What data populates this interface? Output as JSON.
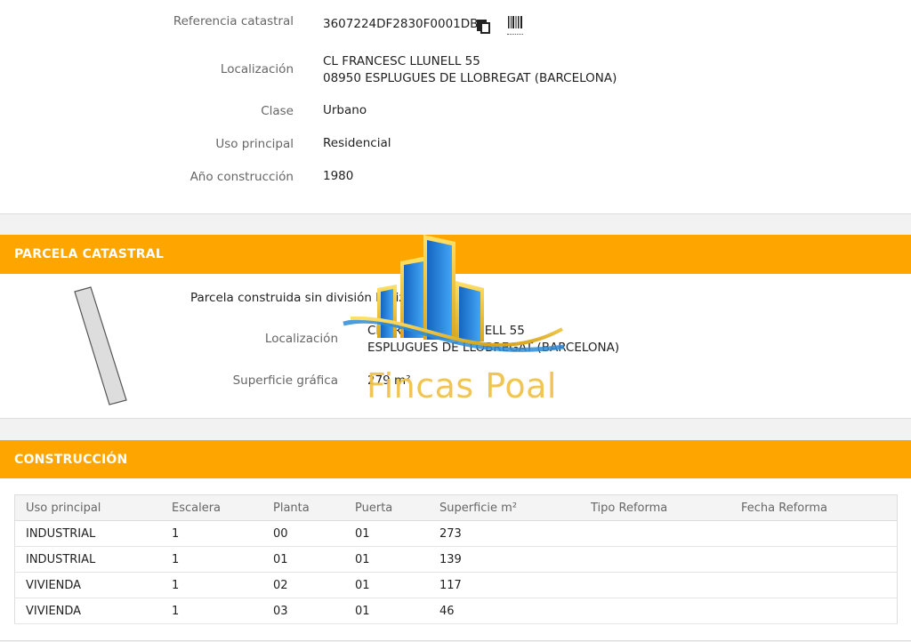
{
  "summary": {
    "ref_label": "Referencia catastral",
    "ref_value": "3607224DF2830F0001DB",
    "loc_label": "Localización",
    "loc_line1": "CL FRANCESC LLUNELL 55",
    "loc_line2": "08950 ESPLUGUES DE LLOBREGAT (BARCELONA)",
    "clase_label": "Clase",
    "clase_value": "Urbano",
    "uso_label": "Uso principal",
    "uso_value": "Residencial",
    "ano_label": "Año construcción",
    "ano_value": "1980",
    "icons": {
      "copy": "copy-icon",
      "barcode": "barcode-icon"
    }
  },
  "parcela": {
    "title": "PARCELA CATASTRAL",
    "description": "Parcela construida sin división horizontal",
    "loc_label": "Localización",
    "loc_line1": "CL FRANCESC LLUNELL 55",
    "loc_line2": "ESPLUGUES DE LLOBREGAT (BARCELONA)",
    "sup_label": "Superficie gráfica",
    "sup_value": "279 m²"
  },
  "construccion": {
    "title": "CONSTRUCCIÓN",
    "columns": [
      "Uso principal",
      "Escalera",
      "Planta",
      "Puerta",
      "Superficie m²",
      "Tipo Reforma",
      "Fecha Reforma"
    ],
    "rows": [
      [
        "INDUSTRIAL",
        "1",
        "00",
        "01",
        "273",
        "",
        ""
      ],
      [
        "INDUSTRIAL",
        "1",
        "01",
        "01",
        "139",
        "",
        ""
      ],
      [
        "VIVIENDA",
        "1",
        "02",
        "01",
        "117",
        "",
        ""
      ],
      [
        "VIVIENDA",
        "1",
        "03",
        "01",
        "46",
        "",
        ""
      ]
    ]
  },
  "watermark": {
    "text": "Fincas Poal"
  },
  "colors": {
    "accent": "#ffa500",
    "label": "#666666",
    "logo_gold": "#f0c24a",
    "logo_blue": "#1e88e5"
  }
}
